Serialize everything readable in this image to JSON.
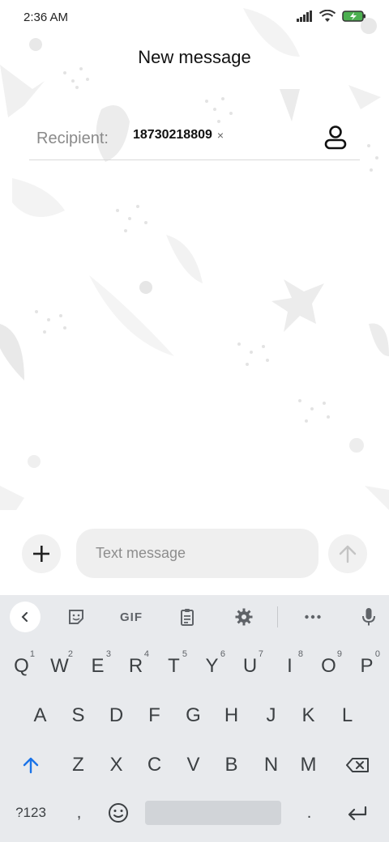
{
  "status_bar": {
    "time": "2:36 AM",
    "icons": [
      "signal-icon",
      "wifi-icon",
      "battery-charging-icon"
    ]
  },
  "header": {
    "title": "New message"
  },
  "recipient": {
    "label": "Recipient:",
    "chip_number": "18730218809",
    "chip_remove": "×",
    "contact_icon": "person-icon"
  },
  "compose": {
    "placeholder": "Text message",
    "value": "",
    "add_icon": "plus-icon",
    "send_icon": "arrow-up-icon"
  },
  "keyboard": {
    "toolbar": {
      "back_icon": "chevron-left-icon",
      "sticker_icon": "sticker-icon",
      "gif_label": "GIF",
      "clipboard_icon": "clipboard-icon",
      "settings_icon": "gear-icon",
      "more_icon": "more-horizontal-icon",
      "mic_icon": "microphone-icon"
    },
    "row1": [
      {
        "key": "Q",
        "hint": "1"
      },
      {
        "key": "W",
        "hint": "2"
      },
      {
        "key": "E",
        "hint": "3"
      },
      {
        "key": "R",
        "hint": "4"
      },
      {
        "key": "T",
        "hint": "5"
      },
      {
        "key": "Y",
        "hint": "6"
      },
      {
        "key": "U",
        "hint": "7"
      },
      {
        "key": "I",
        "hint": "8"
      },
      {
        "key": "O",
        "hint": "9"
      },
      {
        "key": "P",
        "hint": "0"
      }
    ],
    "row2": [
      "A",
      "S",
      "D",
      "F",
      "G",
      "H",
      "J",
      "K",
      "L"
    ],
    "row3": [
      "Z",
      "X",
      "C",
      "V",
      "B",
      "N",
      "M"
    ],
    "row4": {
      "symbols_label": "?123",
      "comma_label": ",",
      "period_label": ".",
      "emoji_icon": "emoji-icon",
      "enter_icon": "enter-icon"
    },
    "shift_icon": "shift-icon",
    "backspace_icon": "backspace-icon"
  },
  "colors": {
    "accent": "#1a73e8",
    "keyboard_bg": "#e8eaed",
    "icon_gray": "#5f6368"
  }
}
